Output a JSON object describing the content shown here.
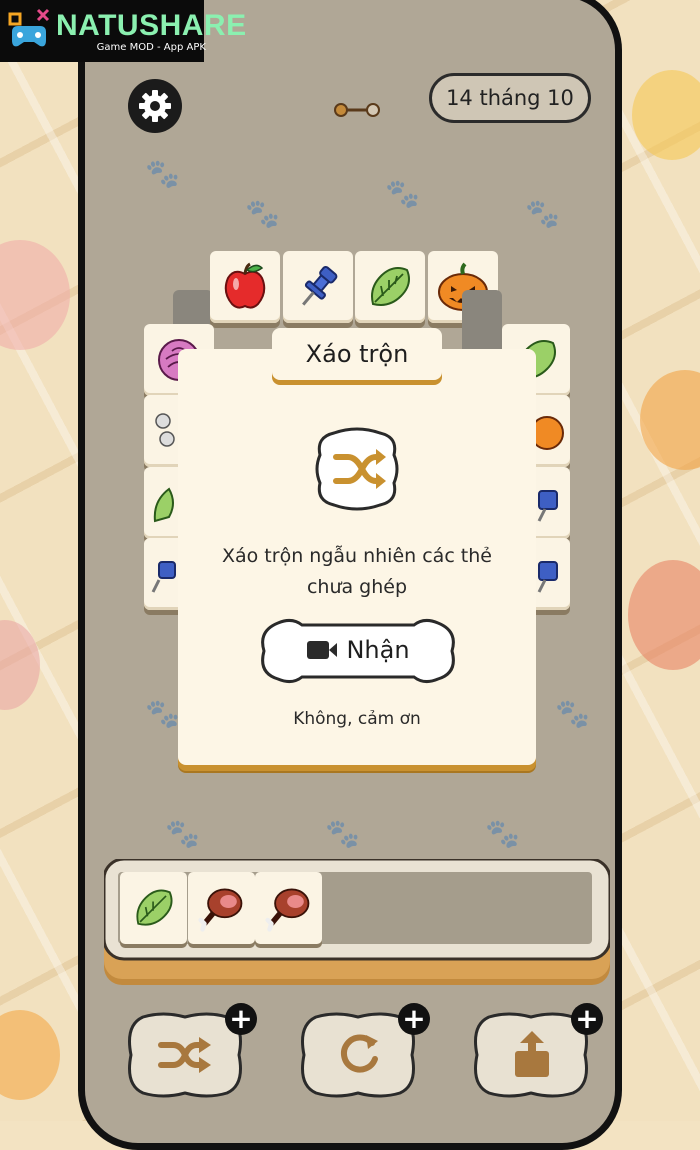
{
  "watermark": {
    "brand": "NATUSHARE",
    "tagline": "Game MOD - App APK"
  },
  "header": {
    "settings_icon": "gear-icon",
    "level_icon": "level-progress-icon",
    "date": "14 tháng 10"
  },
  "board": {
    "top_row": [
      "apple",
      "pushpin",
      "cabbage",
      "pumpkin"
    ],
    "partially_visible": [
      "cabbage",
      "bone",
      "lettuce",
      "pushpin",
      "cabbage",
      "pumpkin",
      "pushpin",
      "pushpin"
    ]
  },
  "dialog": {
    "title": "Xáo trộn",
    "icon": "shuffle-icon",
    "description_line1": "Xáo trộn ngẫu nhiên các thẻ",
    "description_line2": "chưa ghép",
    "claim_label": "Nhận",
    "claim_icon": "video-camera-icon",
    "decline_label": "Không, cảm ơn"
  },
  "tray": {
    "slots": 7,
    "items": [
      "lettuce",
      "meat",
      "meat"
    ]
  },
  "powerups": [
    {
      "name": "shuffle",
      "icon": "shuffle-icon"
    },
    {
      "name": "undo",
      "icon": "undo-icon"
    },
    {
      "name": "pop-out",
      "icon": "pop-out-icon"
    }
  ],
  "colors": {
    "accent": "#c9912f",
    "tile": "#fbf4e4",
    "background": "#b0a796",
    "text": "#1e1e1e"
  }
}
